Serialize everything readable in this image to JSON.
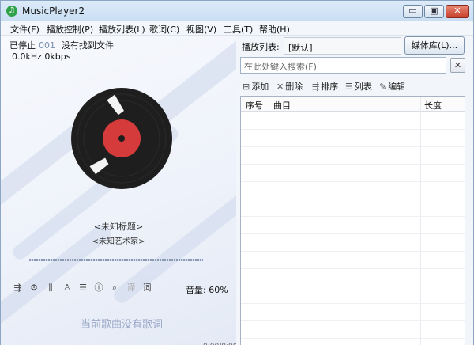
{
  "window": {
    "title": "MusicPlayer2",
    "app_icon": "♫"
  },
  "window_controls": {
    "minimize": "▭",
    "maximize": "▣",
    "close": "✕"
  },
  "menu": [
    "文件(F)",
    "播放控制(P)",
    "播放列表(L)",
    "歌词(C)",
    "视图(V)",
    "工具(T)",
    "帮助(H)"
  ],
  "player": {
    "status": "已停止",
    "track_number": "001",
    "message": "没有找到文件",
    "audio_info": "0.0kHz 0kbps",
    "song_title": "<未知标题>",
    "artist": "<未知艺术家>",
    "progress": 0,
    "volume": "音量: 60%",
    "no_lyrics": "当前歌曲没有歌词",
    "lyric_icon_text": "词",
    "translate_icon_text": "译"
  },
  "controls": [
    {
      "name": "playlist-icon",
      "glyph": "⇶"
    },
    {
      "name": "settings-icon",
      "glyph": "⚙"
    },
    {
      "name": "equalizer-icon",
      "glyph": "⫼"
    },
    {
      "name": "skin-icon",
      "glyph": "♙"
    },
    {
      "name": "menu-icon",
      "glyph": "☰"
    },
    {
      "name": "info-icon",
      "glyph": "ⓘ"
    },
    {
      "name": "search-icon",
      "glyph": "⌕"
    }
  ],
  "playlist": {
    "label": "播放列表:",
    "name": "[默认]",
    "media_library_button": "媒体库(L)...",
    "search_placeholder": "在此处键入搜索(F)",
    "clear_button": "✕",
    "toolbar": {
      "add": "添加",
      "remove": "删除",
      "sort": "排序",
      "list": "列表",
      "edit": "编辑"
    },
    "columns": [
      "序号",
      "曲目",
      "长度"
    ],
    "rows": []
  },
  "colors": {
    "accent": "#2fa24a",
    "vinyl": "#1e1e1e",
    "vinyl_label": "#d63b3b",
    "close_button": "#c8412b"
  }
}
